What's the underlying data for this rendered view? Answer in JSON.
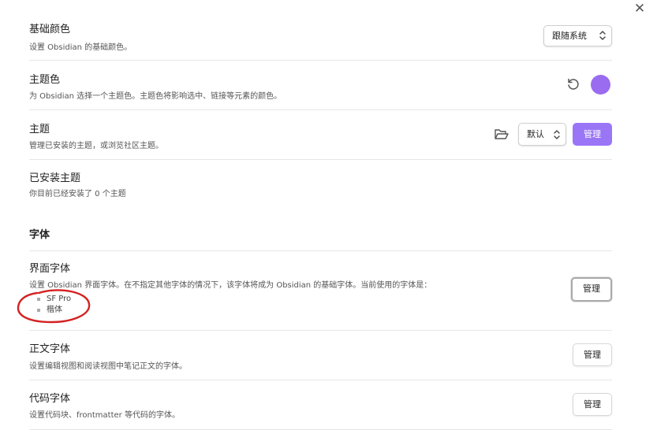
{
  "modal": {
    "close_glyph": "✕"
  },
  "base_color": {
    "title": "基础颜色",
    "desc": "设置 Obsidian 的基础颜色。",
    "dropdown_value": "跟随系统"
  },
  "accent_color": {
    "title": "主题色",
    "desc": "为 Obsidian 选择一个主题色。主题色将影响选中、链接等元素的颜色。",
    "color": "#9a6cf0"
  },
  "theme": {
    "title": "主题",
    "desc": "管理已安装的主题，或浏览社区主题。",
    "dropdown_value": "默认",
    "manage_label": "管理"
  },
  "installed_themes": {
    "title": "已安装主题",
    "desc": "你目前已经安装了 0 个主题"
  },
  "fonts_section": {
    "heading": "字体"
  },
  "interface_font": {
    "title": "界面字体",
    "desc": "设置 Obsidian 界面字体。在不指定其他字体的情况下，该字体将成为 Obsidian 的基础字体。当前使用的字体是：",
    "fonts": [
      "SF Pro",
      "楷体"
    ],
    "manage_label": "管理"
  },
  "text_font": {
    "title": "正文字体",
    "desc": "设置编辑视图和阅读视图中笔记正文的字体。",
    "manage_label": "管理"
  },
  "monospace_font": {
    "title": "代码字体",
    "desc": "设置代码块、frontmatter 等代码的字体。",
    "manage_label": "管理"
  },
  "colors": {
    "accent": "#9a76f7",
    "annotation": "#d42222"
  }
}
